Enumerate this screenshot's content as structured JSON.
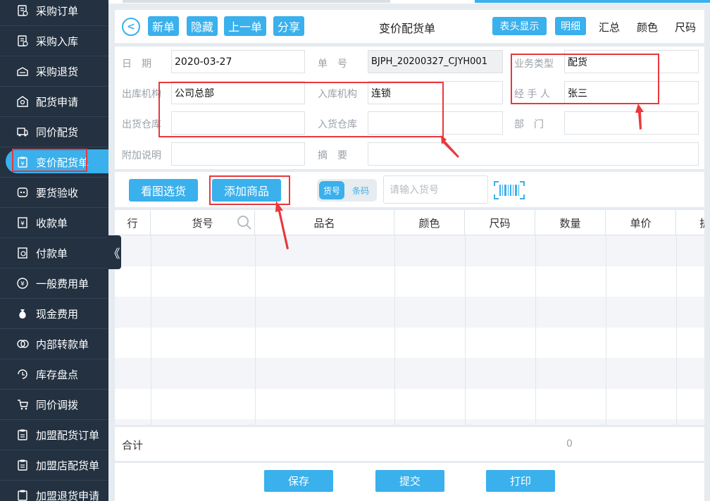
{
  "sidebar": {
    "items": [
      {
        "label": "采购订单",
        "icon": "document-cart-icon"
      },
      {
        "label": "采购入库",
        "icon": "document-in-icon"
      },
      {
        "label": "采购退货",
        "icon": "box-return-icon"
      },
      {
        "label": "配货申请",
        "icon": "store-request-icon"
      },
      {
        "label": "同价配货",
        "icon": "truck-icon"
      },
      {
        "label": "变价配货单",
        "icon": "clipboard-price-icon",
        "active": true
      },
      {
        "label": "要货验收",
        "icon": "inspection-icon"
      },
      {
        "label": "收款单",
        "icon": "receipt-yen-icon"
      },
      {
        "label": "付款单",
        "icon": "payment-icon"
      },
      {
        "label": "一般费用单",
        "icon": "coin-yen-icon"
      },
      {
        "label": "现金费用",
        "icon": "money-bag-icon"
      },
      {
        "label": "内部转款单",
        "icon": "transfer-icon"
      },
      {
        "label": "库存盘点",
        "icon": "inventory-icon"
      },
      {
        "label": "同价调拨",
        "icon": "cart-transfer-icon"
      },
      {
        "label": "加盟配货订单",
        "icon": "clipboard-order-icon"
      },
      {
        "label": "加盟店配货单",
        "icon": "clipboard-list-icon"
      },
      {
        "label": "加盟退货申请",
        "icon": "clipboard-return-icon"
      }
    ],
    "collapse": "《"
  },
  "header": {
    "back": "<",
    "buttons": [
      "新单",
      "隐藏",
      "上一单",
      "分享"
    ],
    "title": "变价配货单",
    "header_display": "表头显示",
    "tabs": {
      "detail": "明细",
      "summary": "汇总",
      "color": "颜色",
      "size": "尺码"
    }
  },
  "form": {
    "date_label": "日　期",
    "date_value": "2020-03-27",
    "no_label": "单　号",
    "no_value": "BJPH_20200327_CJYH001",
    "biz_label": "业务类型",
    "biz_value": "配货",
    "out_org_label": "出库机构",
    "out_org_value": "公司总部",
    "in_org_label": "入库机构",
    "in_org_value": "连锁",
    "handler_label": "经 手 人",
    "handler_value": "张三",
    "out_wh_label": "出货仓库",
    "out_wh_value": "",
    "in_wh_label": "入货仓库",
    "in_wh_value": "",
    "dept_label": "部　门",
    "dept_value": "",
    "note_label": "附加说明",
    "note_value": "",
    "summary_label": "摘　要",
    "summary_value": ""
  },
  "toolbar": {
    "view_pick": "看图选货",
    "add_goods": "添加商品",
    "mode_on": "货号",
    "mode_off": "条码",
    "search_placeholder": "请输入货号"
  },
  "table": {
    "columns": [
      "行",
      "货号",
      "品名",
      "颜色",
      "尺码",
      "数量",
      "单价",
      "折"
    ]
  },
  "summary": {
    "label": "合计",
    "qty": "0"
  },
  "actions": {
    "save": "保存",
    "submit": "提交",
    "print": "打印"
  },
  "colors": {
    "accent": "#3ab0ec",
    "sidebar": "#233141",
    "annotation": "#e8383d"
  }
}
